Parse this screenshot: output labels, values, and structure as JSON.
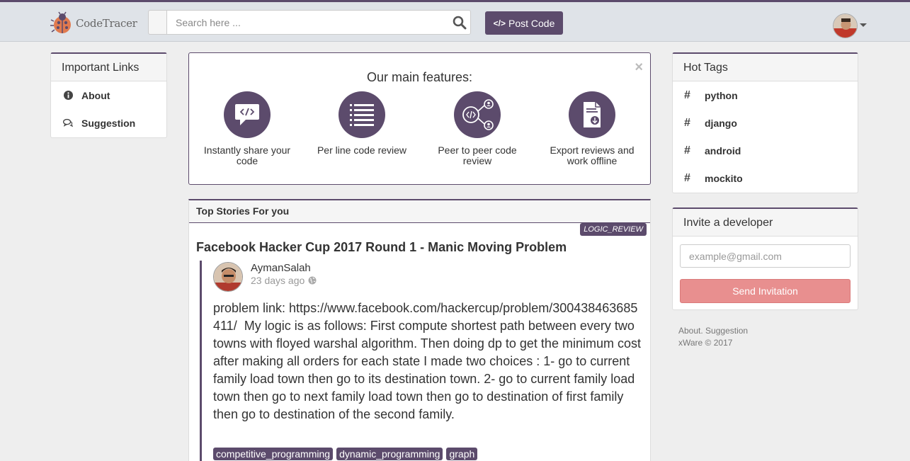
{
  "header": {
    "logo_text": "CodeTracer",
    "search_placeholder": "Search here ...",
    "post_code_icon": "</>",
    "post_code_label": "Post Code"
  },
  "important_links": {
    "title": "Important Links",
    "items": [
      {
        "label": "About",
        "icon": "info-icon"
      },
      {
        "label": "Suggestion",
        "icon": "comments-icon"
      }
    ]
  },
  "features": {
    "title": "Our main features:",
    "close_glyph": "×",
    "items": [
      {
        "label": "Instantly share your code",
        "icon": "share-code-icon"
      },
      {
        "label": "Per line code review",
        "icon": "list-lines-icon"
      },
      {
        "label": "Peer to peer code review",
        "icon": "peer-review-icon"
      },
      {
        "label": "Export reviews and work offline",
        "icon": "export-file-icon"
      }
    ]
  },
  "stories": {
    "title": "Top Stories For you",
    "items": [
      {
        "type_badge": "LOGIC_REVIEW",
        "title": "Facebook Hacker Cup 2017 Round 1 - Manic Moving Problem",
        "author": "AymanSalah",
        "time": "23 days ago",
        "body_link": "problem link: https://www.facebook.com/hackercup/problem/300438463685411/",
        "body_text": "My logic is as follows: First compute shortest path between every two towns with floyed warshal algorithm. Then doing dp to get the minimum cost after making all orders for each state I made two choices : 1- go to current family load town then go to its destination town. 2- go to current family load town then go to next family load town then go to destination of first family then go to destination of the second family.",
        "tags": [
          "competitive_programming",
          "dynamic_programming",
          "graph"
        ]
      }
    ]
  },
  "hot_tags": {
    "title": "Hot Tags",
    "hash": "#",
    "items": [
      "python",
      "django",
      "android",
      "mockito"
    ]
  },
  "invite": {
    "title": "Invite a developer",
    "placeholder": "example@gmail.com",
    "button_label": "Send Invitation"
  },
  "footer": {
    "about": "About.",
    "suggestion": "Suggestion",
    "copyright": "xWare © 2017"
  },
  "colors": {
    "brand": "#5c4b6c",
    "invite_button": "#e88f8f",
    "background": "#eeeeee"
  }
}
